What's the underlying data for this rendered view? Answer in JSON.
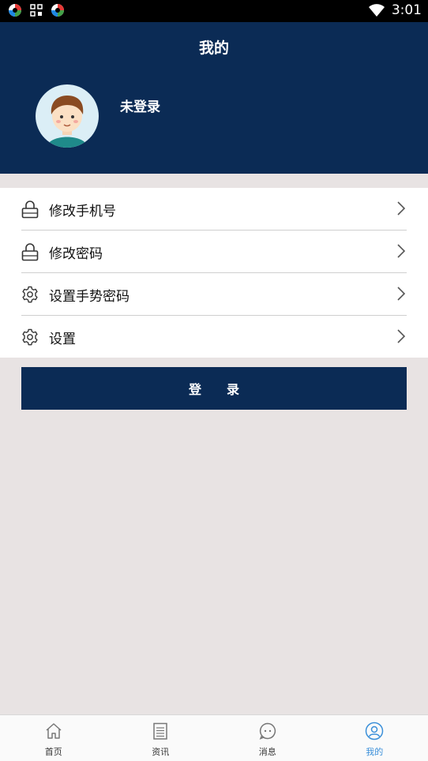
{
  "status_bar": {
    "time": "3:01",
    "icons": [
      "app-icon",
      "qr-icon",
      "app-icon",
      "wifi-icon"
    ]
  },
  "header": {
    "title": "我的",
    "username": "未登录",
    "avatar": "avatar-boy"
  },
  "menu": [
    {
      "label": "修改手机号",
      "icon": "lock-icon"
    },
    {
      "label": "修改密码",
      "icon": "lock-icon"
    },
    {
      "label": "设置手势密码",
      "icon": "gear-icon"
    },
    {
      "label": "设置",
      "icon": "gear-icon"
    }
  ],
  "login_button": {
    "label": "登录"
  },
  "tabbar": [
    {
      "label": "首页",
      "icon": "home-icon"
    },
    {
      "label": "资讯",
      "icon": "document-icon"
    },
    {
      "label": "消息",
      "icon": "chat-icon"
    },
    {
      "label": "我的",
      "icon": "user-icon",
      "active": true
    }
  ],
  "colors": {
    "primary": "#0b2b55",
    "background": "#e8e3e3",
    "active_tab": "#3a8fd9"
  }
}
